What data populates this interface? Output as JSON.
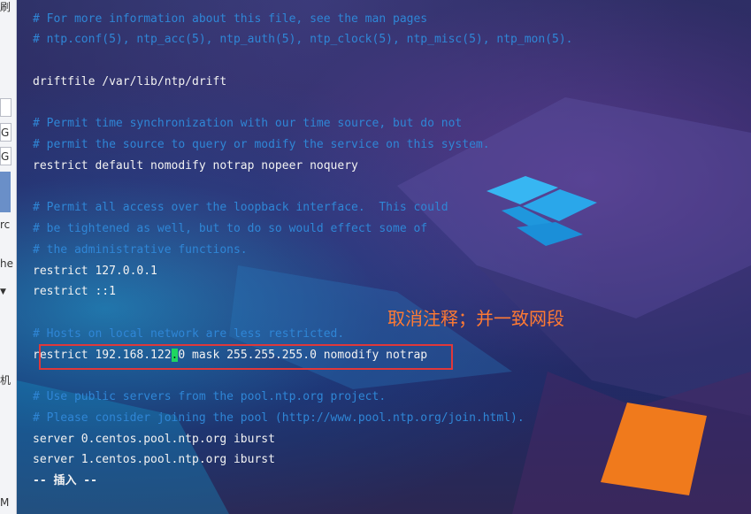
{
  "sidebar": {
    "fragments": [
      "刷",
      "G",
      "G",
      "rc",
      "he",
      "机",
      "M"
    ]
  },
  "terminal": {
    "lines": [
      {
        "text": "# For more information about this file, see the man pages",
        "kind": "comment"
      },
      {
        "text": "# ntp.conf(5), ntp_acc(5), ntp_auth(5), ntp_clock(5), ntp_misc(5), ntp_mon(5).",
        "kind": "comment"
      },
      {
        "text": "driftfile /var/lib/ntp/drift",
        "kind": "code"
      },
      {
        "text": "# Permit time synchronization with our time source, but do not",
        "kind": "comment"
      },
      {
        "text": "# permit the source to query or modify the service on this system.",
        "kind": "comment"
      },
      {
        "text": "restrict default nomodify notrap nopeer noquery",
        "kind": "code"
      },
      {
        "text": "# Permit all access over the loopback interface.  This could",
        "kind": "comment"
      },
      {
        "text": "# be tightened as well, but to do so would effect some of",
        "kind": "comment"
      },
      {
        "text": "# the administrative functions.",
        "kind": "comment"
      },
      {
        "text": "restrict 127.0.0.1",
        "kind": "code"
      },
      {
        "text": "restrict ::1",
        "kind": "code"
      },
      {
        "text": "# Hosts on local network are less restricted.",
        "kind": "comment"
      },
      {
        "text_before": "restrict 192.168.122",
        "cursor_char": ".",
        "text_after": "0 mask 255.255.255.0 nomodify notrap",
        "kind": "code"
      },
      {
        "text": "# Use public servers from the pool.ntp.org project.",
        "kind": "comment"
      },
      {
        "text": "# Please consider joining the pool (http://www.pool.ntp.org/join.html).",
        "kind": "comment"
      },
      {
        "text": "server 0.centos.pool.ntp.org iburst",
        "kind": "code"
      },
      {
        "text": "server 1.centos.pool.ntp.org iburst",
        "kind": "code"
      }
    ],
    "mode_line": "-- 插入 --"
  },
  "annotation": {
    "text": "取消注释；并一致网段",
    "color": "#ff7a33",
    "box_color": "#e0383a"
  },
  "colors": {
    "comment": "#2f86d6",
    "code": "#f2f2f2",
    "cursor": "#1ed760"
  }
}
